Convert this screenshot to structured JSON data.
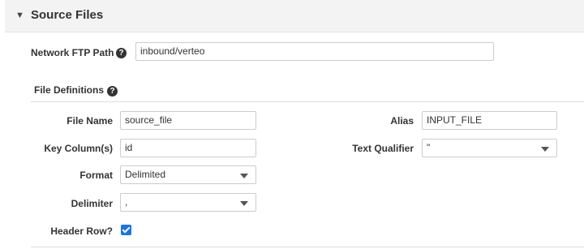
{
  "section": {
    "title": "Source Files",
    "toggle_icon": "caret-down-icon"
  },
  "network_ftp_path": {
    "label": "Network FTP Path",
    "value": "inbound/verteo"
  },
  "file_definitions": {
    "heading": "File Definitions"
  },
  "fields": {
    "file_name": {
      "label": "File Name",
      "value": "source_file"
    },
    "alias": {
      "label": "Alias",
      "value": "INPUT_FILE"
    },
    "key_columns": {
      "label": "Key Column(s)",
      "value": "id"
    },
    "text_qualifier": {
      "label": "Text Qualifier",
      "value": "\""
    },
    "format": {
      "label": "Format",
      "value": "Delimited"
    },
    "delimiter": {
      "label": "Delimiter",
      "value": ","
    },
    "header_row": {
      "label": "Header Row?",
      "checked": true
    }
  },
  "help_glyph": "?",
  "colors": {
    "checkbox_accent": "#1a73e8",
    "header_bg": "#f3f3f3"
  }
}
